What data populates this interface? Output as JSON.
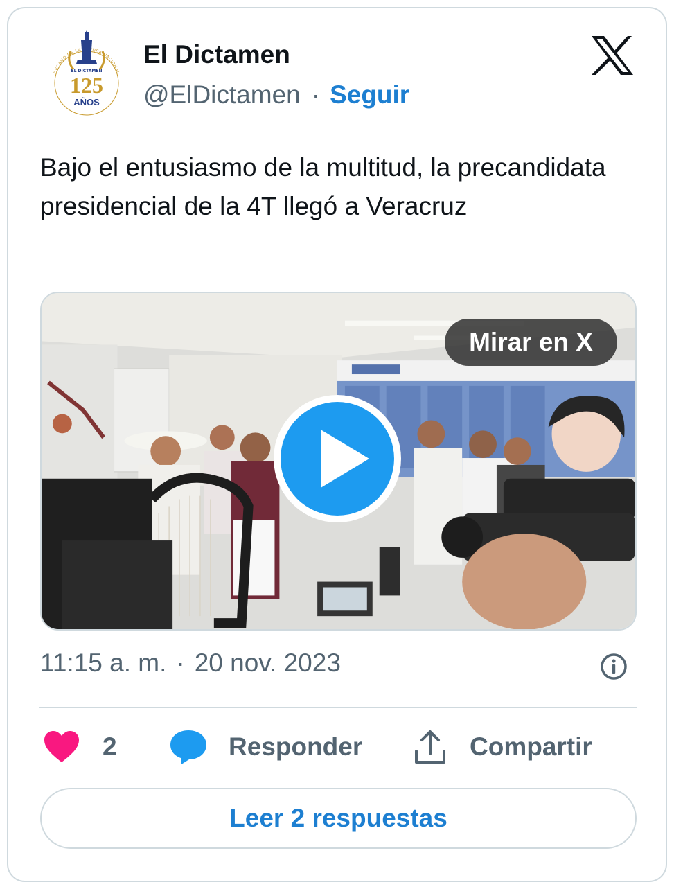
{
  "author": {
    "name": "El Dictamen",
    "handle": "@ElDictamen",
    "separator": "·",
    "follow_label": "Seguir",
    "avatar_text": {
      "top": "EL DICTAMEN",
      "number": "125",
      "bottom": "AÑOS",
      "ring": "DECANO DE LA PRENSA NACIONAL"
    }
  },
  "platform_icon": "x-logo-icon",
  "tweet": {
    "text": "Bajo el entusiasmo de la multitud, la precandidata presidencial de la 4T llegó a Veracruz"
  },
  "media": {
    "watch_label": "Mirar en X",
    "play_icon": "play-icon"
  },
  "meta": {
    "time": "11:15 a. m.",
    "separator": "·",
    "date": "20 nov. 2023",
    "info_icon": "info-icon"
  },
  "actions": {
    "like_count": "2",
    "reply_label": "Responder",
    "share_label": "Compartir"
  },
  "replies_button": {
    "label": "Leer 2 respuestas"
  },
  "colors": {
    "accent": "#1d9bf0",
    "link": "#1d7fd1",
    "heart": "#f91880",
    "text": "#0f1419",
    "muted": "#536471",
    "border": "#cfd9de",
    "avatar_gold": "#c89a2c",
    "avatar_blue": "#27408b"
  }
}
